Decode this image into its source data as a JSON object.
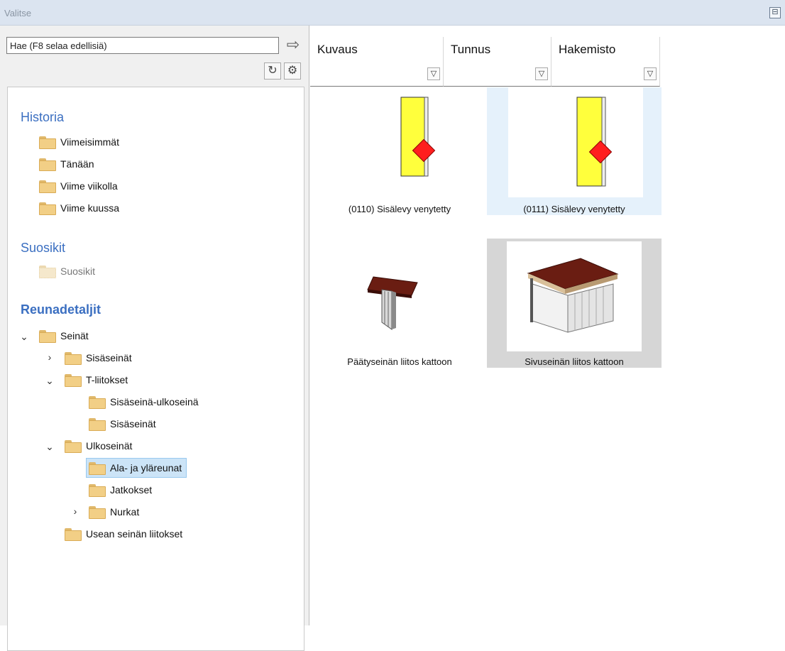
{
  "window": {
    "title": "Valitse"
  },
  "search": {
    "placeholder": "Hae (F8 selaa edellisiä)"
  },
  "icons": {
    "go": "arrow-right-icon",
    "refresh": "refresh-icon",
    "settings": "gear-icon",
    "filter": "filter-funnel-icon",
    "folder": "folder-icon",
    "pin": "pin-icon"
  },
  "tree": {
    "history": {
      "title": "Historia",
      "items": [
        "Viimeisimmät",
        "Tänään",
        "Viime viikolla",
        "Viime kuussa"
      ]
    },
    "favorites": {
      "title": "Suosikit",
      "items": [
        "Suosikit"
      ]
    },
    "edge_details": {
      "title": "Reunadetaljit",
      "nodes": [
        {
          "label": "Seinät",
          "expanded": true
        },
        {
          "label": "Sisäseinät",
          "expanded": false
        },
        {
          "label": "T-liitokset",
          "expanded": true
        },
        {
          "label": "Sisäseinä-ulkoseinä"
        },
        {
          "label": "Sisäseinät"
        },
        {
          "label": "Ulkoseinät",
          "expanded": true
        },
        {
          "label": "Ala- ja yläreunat",
          "selected": true
        },
        {
          "label": "Jatkokset"
        },
        {
          "label": "Nurkat",
          "expanded": false
        },
        {
          "label": "Usean seinän liitokset"
        }
      ]
    }
  },
  "columns": [
    "Kuvaus",
    "Tunnus",
    "Hakemisto"
  ],
  "items": [
    {
      "caption": "(0110) Sisälevy venytetty",
      "state": "normal"
    },
    {
      "caption": "(0111) Sisälevy venytetty",
      "state": "hover"
    },
    {
      "caption": "Päätyseinän liitos kattoon",
      "state": "normal"
    },
    {
      "caption": "Sivuseinän liitos kattoon",
      "state": "selected"
    }
  ],
  "colors": {
    "accent": "#3b6fc1",
    "selection": "#cce4f7",
    "hover": "#e5f1fb",
    "folder": "#f2cf86",
    "panel_yellow": "#ffff3c",
    "marker_red": "#ff1e1e",
    "roof_brown": "#6a1d12"
  }
}
